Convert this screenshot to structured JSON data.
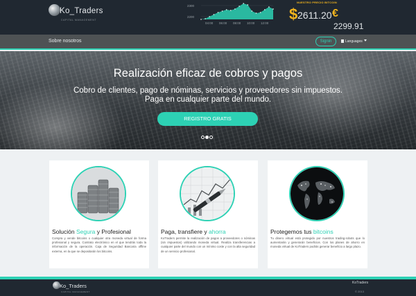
{
  "header": {
    "logo_text": "Ko_Traders",
    "logo_sub": "CAPITAL MANAGEMENT",
    "price_label": "NUESTRO PRECIO BITCOIN",
    "usd_symbol": "$",
    "usd_value": "2611.20",
    "eur_symbol": "€",
    "eur_value": "2299.91"
  },
  "chart_data": {
    "type": "area",
    "x": [
      "04:00",
      "06:00",
      "08:00",
      "10:00",
      "12:00"
    ],
    "y_ticks": [
      "2300",
      "2200"
    ],
    "values": [
      2180,
      2185,
      2200,
      2215,
      2230,
      2240,
      2250,
      2245,
      2255,
      2275,
      2295,
      2285,
      2240,
      2225,
      2230,
      2250,
      2270,
      2255
    ],
    "colors": {
      "fill": "#2dd1b4",
      "line": "#ffffff"
    }
  },
  "nav": {
    "about": "Sobre nosotros",
    "signin": "Signin",
    "languages": "Languages"
  },
  "hero": {
    "title": "Realización eficaz de cobros y pagos",
    "subtitle_line1": "Cobro de clientes, pago de nóminas, servicios y proveedores sin impuestos.",
    "subtitle_line2": "Paga en cualquier parte del mundo.",
    "cta": "REGISTRO GRATIS"
  },
  "cards": [
    {
      "title_pre": "Solución ",
      "title_hl": "Segura",
      "title_post": " y Profesional",
      "icon": "coins-image",
      "body": "Compra y vende bitcoins o cualquier otra moneda virtual de forma profesional y segura. Contrato electrónico en el que tendrás toda la información de la operación. Caja de Seguridad Bancaria offline externa, en la que se depositarán los bitcoins."
    },
    {
      "title_pre": "Paga, transfiere y ",
      "title_hl": "ahorra",
      "title_post": "",
      "icon": "pen-chart-image",
      "body": "KoTraders permite la realización de pagos a proveedores o nóminas (sin impuestos) utilizando moneda virtual. Realiza transferencias a cualquier parte del mundo con un mínimo coste y con la alta seguridad de un servicio profesional."
    },
    {
      "title_pre": "Protegemos tus ",
      "title_hl": "bitcoins",
      "title_post": "",
      "icon": "world-map-image",
      "body": "Tu dinero virtual está protegido por nuestros trading-robots que lo aumentarán y generarán beneficios. Con los planes de ahorro en moneda virtual de KoTraders podrás generar beneficio a largo plazo."
    }
  ],
  "footer": {
    "logo_text": "Ko_Traders",
    "logo_sub": "CAPITAL MANAGEMENT",
    "link": "KoTraders",
    "copyright": "© 2013"
  }
}
